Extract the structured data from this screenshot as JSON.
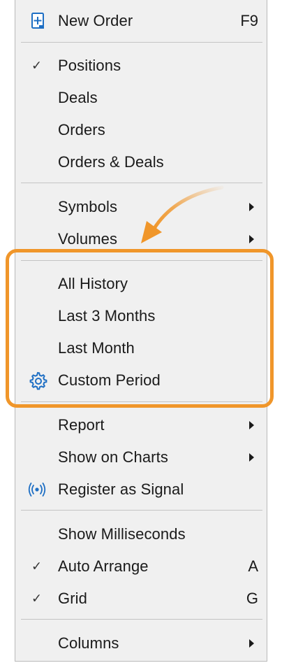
{
  "menu": {
    "new_order": {
      "label": "New Order",
      "shortcut": "F9",
      "icon": "new-order-icon"
    },
    "positions": {
      "label": "Positions",
      "checked": true
    },
    "deals": {
      "label": "Deals"
    },
    "orders": {
      "label": "Orders"
    },
    "orders_deals": {
      "label": "Orders & Deals"
    },
    "symbols": {
      "label": "Symbols"
    },
    "volumes": {
      "label": "Volumes"
    },
    "all_history": {
      "label": "All History"
    },
    "last_3_months": {
      "label": "Last 3 Months"
    },
    "last_month": {
      "label": "Last Month"
    },
    "custom_period": {
      "label": "Custom Period",
      "icon": "gear-icon"
    },
    "report": {
      "label": "Report"
    },
    "show_on_charts": {
      "label": "Show on Charts"
    },
    "register_signal": {
      "label": "Register as Signal",
      "icon": "signal-icon"
    },
    "show_ms": {
      "label": "Show Milliseconds"
    },
    "auto_arrange": {
      "label": "Auto Arrange",
      "shortcut": "A",
      "checked": true
    },
    "grid": {
      "label": "Grid",
      "shortcut": "G",
      "checked": true
    },
    "columns": {
      "label": "Columns"
    }
  },
  "colors": {
    "highlight": "#f0962a",
    "arrow": "#f0962a",
    "icon_blue": "#1e6fc4"
  }
}
